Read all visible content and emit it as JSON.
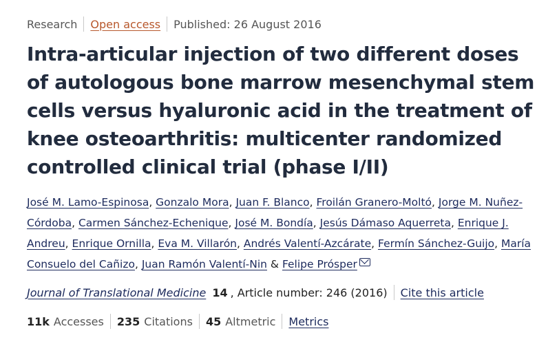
{
  "meta": {
    "type": "Research",
    "access": "Open access",
    "published": "Published: 26 August 2016"
  },
  "title": "Intra-articular injection of two different doses of autologous bone marrow mesenchymal stem cells versus hyaluronic acid in the treatment of knee osteoarthritis: multicenter randomized controlled clinical trial (phase I/II)",
  "authors": [
    "José M. Lamo-Espinosa",
    "Gonzalo Mora",
    "Juan F. Blanco",
    "Froilán Granero-Moltó",
    "Jorge M. Nuñez-Córdoba",
    "Carmen Sánchez-Echenique",
    "José M. Bondía",
    "Jesús Dámaso Aquerreta",
    "Enrique J. Andreu",
    "Enrique Ornilla",
    "Eva M. Villarón",
    "Andrés Valentí-Azcárate",
    "Fermín Sánchez-Guijo",
    "María Consuelo del Cañizo",
    "Juan Ramón Valentí-Nin",
    "Felipe Prósper"
  ],
  "author_separator": ", ",
  "author_last_separator": " & ",
  "corresponding_icon": "envelope-icon",
  "citation": {
    "journal": "Journal of Translational Medicine",
    "volume": "14",
    "article": ", Article number: 246 (2016)",
    "cite_label": "Cite this article"
  },
  "metrics": {
    "accesses_value": "11k",
    "accesses_label": "Accesses",
    "citations_value": "235",
    "citations_label": "Citations",
    "altmetric_value": "45",
    "altmetric_label": "Altmetric",
    "metrics_link": "Metrics"
  },
  "colors": {
    "title": "#222c3e",
    "link": "#1c2a5c",
    "open_access": "#b7572b",
    "muted": "#555555"
  }
}
